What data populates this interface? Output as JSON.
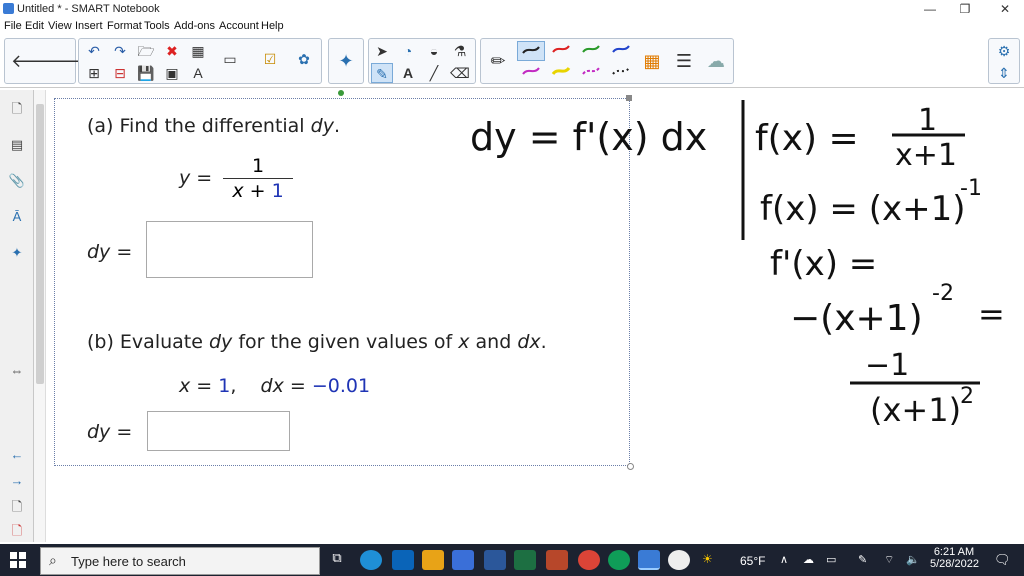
{
  "window": {
    "title": "Untitled * - SMART Notebook",
    "minimize_icon": "minimize-icon",
    "restore_icon": "restore-icon",
    "close_icon": "close-icon"
  },
  "menu": [
    "File",
    "Edit",
    "View",
    "Insert",
    "Format",
    "Tools",
    "Add-ons",
    "Account",
    "Help"
  ],
  "problem": {
    "part_a": {
      "prefix": "(a) Find the differential ",
      "var": "dy",
      "suffix": ".",
      "y_label": "y =",
      "numerator": "1",
      "denominator_text": "x + ",
      "denominator_blue": "1",
      "answer_label": "dy ="
    },
    "part_b": {
      "prefix": "(b) Evaluate ",
      "var1": "dy",
      "middle": " for the given values of ",
      "var2": "x",
      "and": " and ",
      "var3": "dx",
      "suffix": ".",
      "x_label": "x = ",
      "x_value": "1",
      "dx_label": "dx = ",
      "dx_value": "−0.01",
      "answer_label": "dy ="
    }
  },
  "handwriting": {
    "line1": "dy = f'(x) dx",
    "f_label": "f(x) =",
    "f_num": "1",
    "f_den": "x+1",
    "f_power": "f(x) = (x+1)",
    "f_power_exp": "-1",
    "fprime": "f'(x) =",
    "deriv": "−(x+1)",
    "deriv_exp": "-2",
    "equals": "=",
    "final_num": "−1",
    "final_den": "(x+1)",
    "final_exp": "2"
  },
  "taskbar": {
    "search_placeholder": "Type here to search",
    "weather": "65°F",
    "time": "6:21 AM",
    "date": "5/28/2022"
  }
}
